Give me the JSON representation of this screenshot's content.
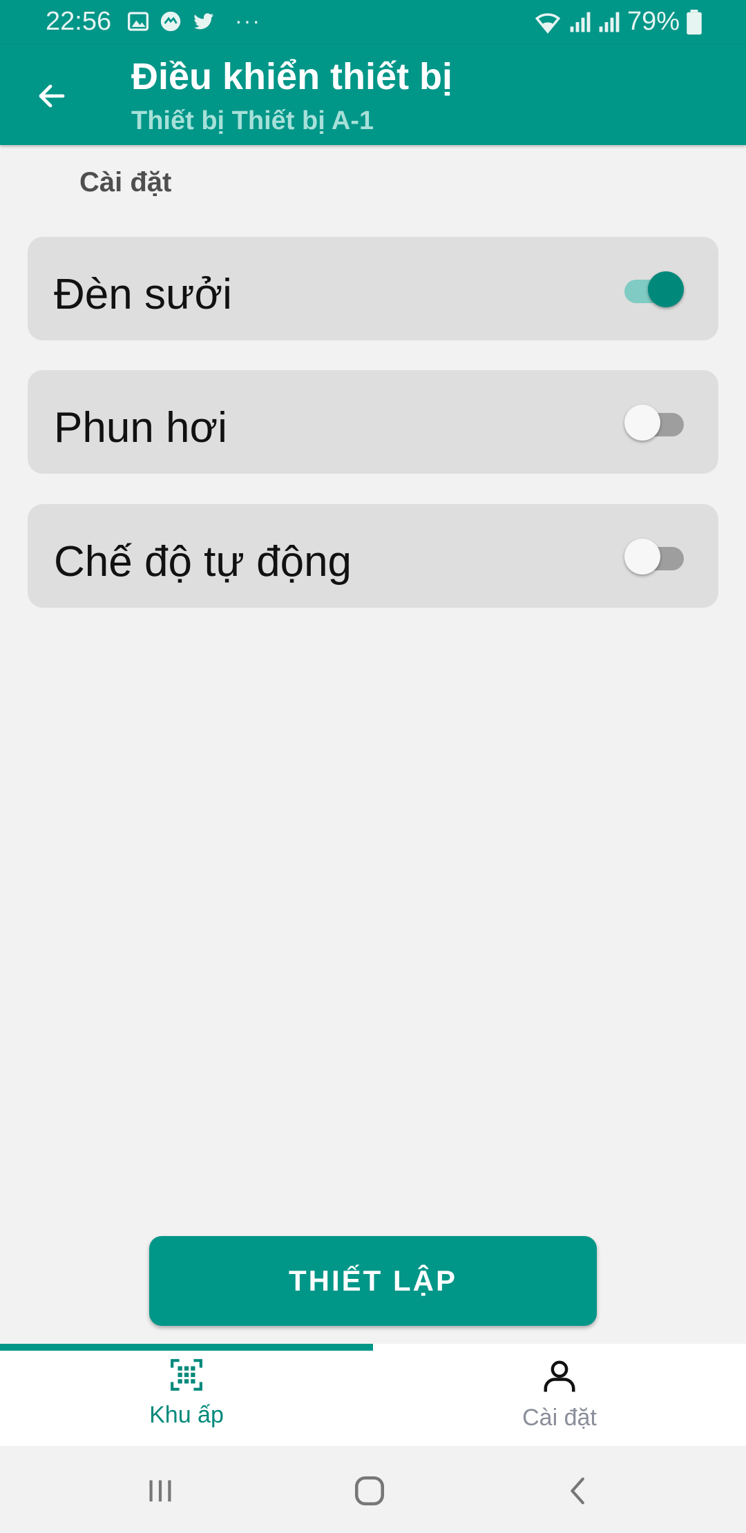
{
  "status_bar": {
    "time": "22:56",
    "battery_percent": "79%",
    "left_icons": [
      "image-icon",
      "messenger-icon",
      "twitter-icon",
      "more-dots-icon"
    ],
    "right_icons": [
      "wifi-icon",
      "signal-icon",
      "signal-icon",
      "battery-icon"
    ],
    "overflow": "···"
  },
  "app_bar": {
    "title": "Điều khiển thiết bị",
    "subtitle": "Thiết bị Thiết bị A-1",
    "back_icon": "arrow-left-icon"
  },
  "section": {
    "label": "Cài đặt"
  },
  "toggles": [
    {
      "label": "Đèn sưởi",
      "on": true
    },
    {
      "label": "Phun hơi",
      "on": false
    },
    {
      "label": "Chế độ tự động",
      "on": false
    }
  ],
  "action_button": {
    "label": "THIẾT LẬP"
  },
  "bottom_nav": {
    "items": [
      {
        "label": "Khu ấp",
        "icon": "grid-scan-icon",
        "active": true
      },
      {
        "label": "Cài đặt",
        "icon": "person-icon",
        "active": false
      }
    ]
  },
  "colors": {
    "primary": "#009688",
    "primary_dark": "#00897b",
    "subtitle": "#a6e0d9",
    "card": "#dedede",
    "background": "#f2f2f2"
  }
}
